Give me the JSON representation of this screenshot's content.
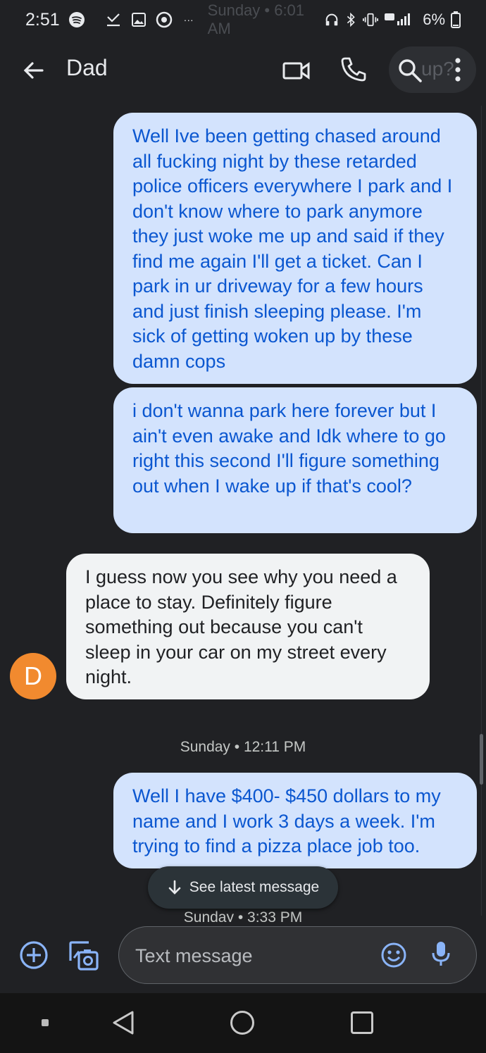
{
  "status_bar": {
    "time": "2:51",
    "ghost_text": "Sunday • 6:01 AM",
    "battery": "6%"
  },
  "app_bar": {
    "title": "Dad",
    "search_ghost": "up?"
  },
  "messages": [
    {
      "direction": "outgoing",
      "text": "Well Ive been getting chased around all fucking night by these retarded police officers everywhere I park and I don't know where to park anymore they just woke me up and said if they find me again I'll get a ticket. Can I park in ur driveway for a few hours and just finish sleeping please. I'm sick of getting woken up by these damn cops"
    },
    {
      "direction": "outgoing",
      "text": "i don't wanna park here forever but I ain't even awake and Idk where to go right this second I'll figure something out when I wake up if that's cool?"
    },
    {
      "direction": "incoming",
      "avatar_letter": "D",
      "text": "I guess now you see why you need a place to stay. Definitely figure something out because you can't sleep in your car on my street every night."
    },
    {
      "direction": "outgoing",
      "text": "Well I have $400- $450 dollars to my name and I work 3 days a week. I'm trying to find a pizza place job too."
    }
  ],
  "timestamps": {
    "first": "Sunday • 12:11 PM",
    "second": "Sunday • 3:33 PM"
  },
  "latest_button": {
    "label": "See latest message"
  },
  "composer": {
    "placeholder": "Text message"
  },
  "colors": {
    "background": "#202124",
    "outgoing_bubble": "#d3e3fd",
    "outgoing_text": "#0b57d0",
    "incoming_bubble": "#f1f3f4",
    "avatar": "#f18a2f",
    "accent": "#8ab4f8"
  }
}
